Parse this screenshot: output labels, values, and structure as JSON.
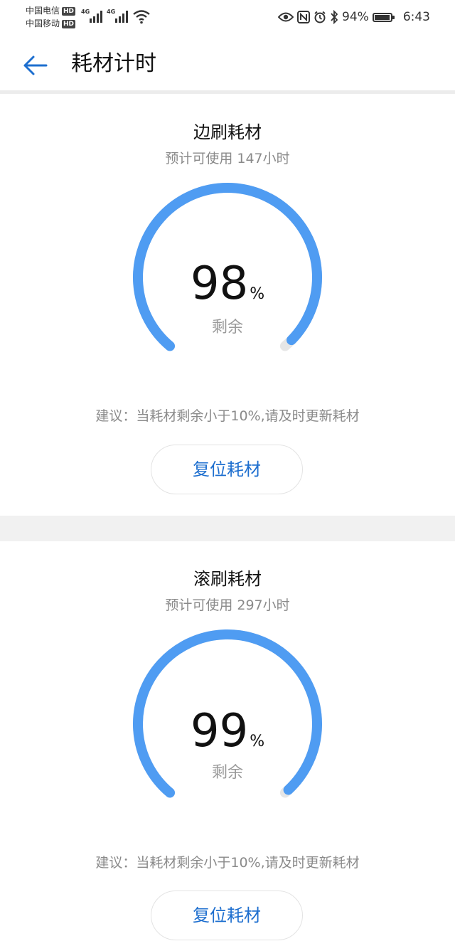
{
  "status_bar": {
    "carrier1": "中国电信",
    "carrier2": "中国移动",
    "hd_label": "HD",
    "network1": "4G",
    "network2": "4G",
    "battery_percent": "94%",
    "battery_level": 0.94,
    "time": "6:43",
    "icons": [
      "eye-icon",
      "nfc-icon",
      "alarm-icon",
      "bluetooth-icon",
      "battery-icon"
    ]
  },
  "header": {
    "title": "耗材计时",
    "back_icon": "arrow-left-icon"
  },
  "accent_color": "#4f9cf2",
  "consumables": [
    {
      "name": "边刷耗材",
      "estimate": "预计可使用 147小时",
      "percent": "98",
      "percent_value": 98,
      "unit": "%",
      "remaining_label": "剩余",
      "advice": "建议：当耗材剩余小于10%,请及时更新耗材",
      "reset_label": "复位耗材"
    },
    {
      "name": "滚刷耗材",
      "estimate": "预计可使用 297小时",
      "percent": "99",
      "percent_value": 99,
      "unit": "%",
      "remaining_label": "剩余",
      "advice": "建议：当耗材剩余小于10%,请及时更新耗材",
      "reset_label": "复位耗材"
    }
  ]
}
